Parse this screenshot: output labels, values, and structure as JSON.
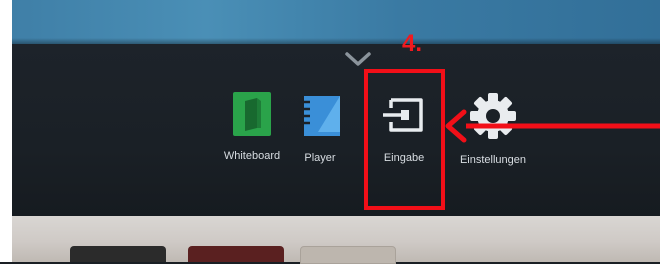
{
  "dock": {
    "apps": [
      {
        "label": "Whiteboard",
        "icon": "whiteboard-icon"
      },
      {
        "label": "Player",
        "icon": "player-icon"
      },
      {
        "label": "Eingabe",
        "icon": "input-source-icon"
      },
      {
        "label": "Einstellungen",
        "icon": "gear-icon"
      }
    ]
  },
  "annotation": {
    "step_label": "4.",
    "color": "#f20f18"
  },
  "colors": {
    "whiteboard_green": "#2aa34a",
    "player_blue": "#3a8fd8",
    "dock_bg": "#1b2127"
  }
}
